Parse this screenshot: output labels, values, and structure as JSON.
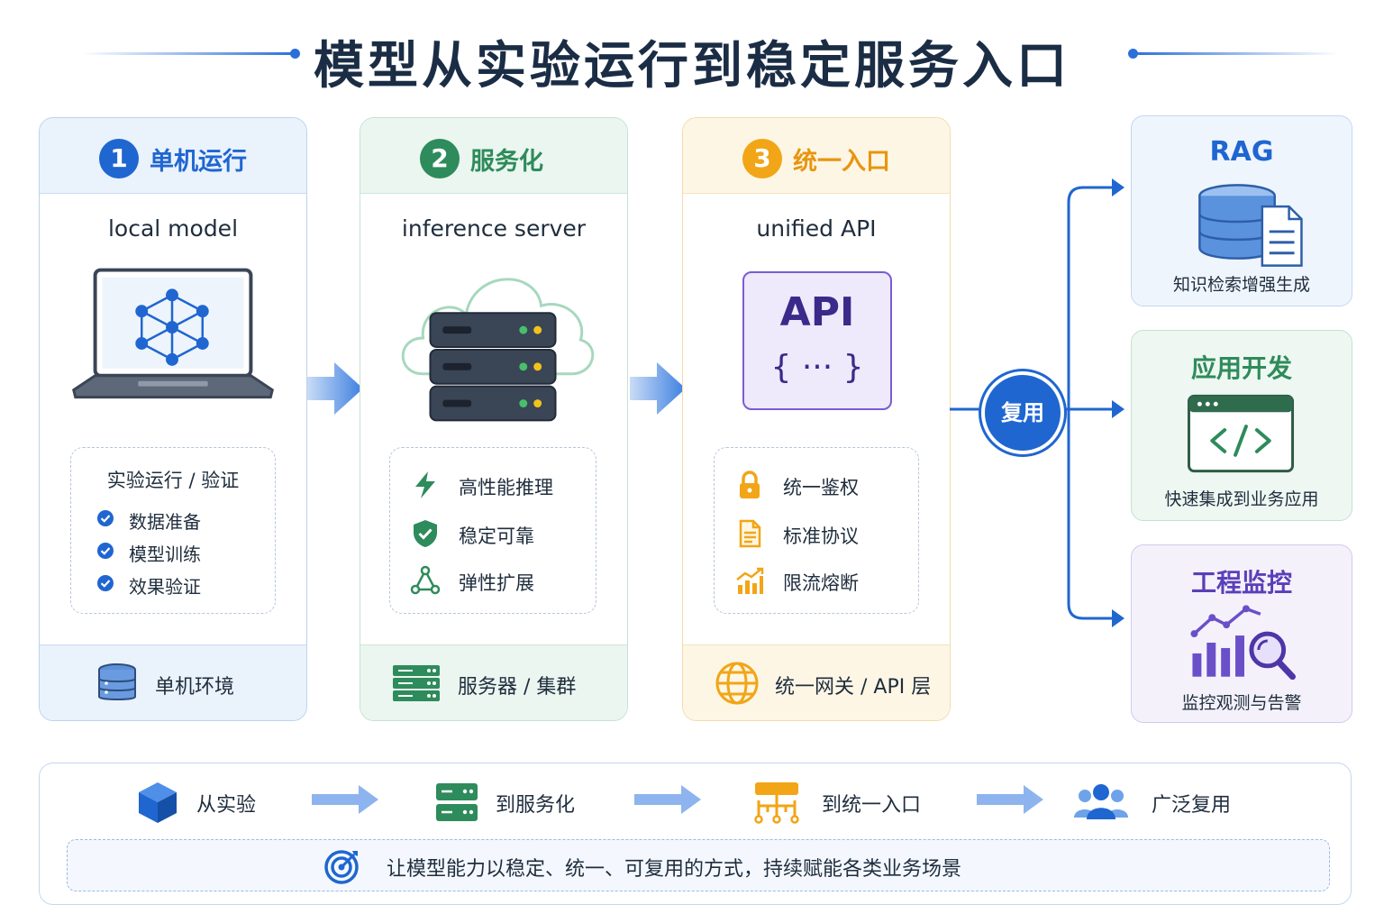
{
  "title": "模型从实验运行到稳定服务入口",
  "stages": [
    {
      "num": "1",
      "title": "单机运行",
      "subtitle": "local model",
      "box_title": "实验运行 / 验证",
      "items": [
        "数据准备",
        "模型训练",
        "效果验证"
      ],
      "footer": "单机环境"
    },
    {
      "num": "2",
      "title": "服务化",
      "subtitle": "inference server",
      "items": [
        "高性能推理",
        "稳定可靠",
        "弹性扩展"
      ],
      "footer": "服务器 / 集群"
    },
    {
      "num": "3",
      "title": "统一入口",
      "subtitle": "unified API",
      "api_label": "API",
      "api_braces": "{ ··· }",
      "items": [
        "统一鉴权",
        "标准协议",
        "限流熔断"
      ],
      "footer": "统一网关 / API 层"
    }
  ],
  "reuse_label": "复用",
  "outputs": [
    {
      "title": "RAG",
      "desc": "知识检索增强生成"
    },
    {
      "title": "应用开发",
      "desc": "快速集成到业务应用"
    },
    {
      "title": "工程监控",
      "desc": "监控观测与告警"
    }
  ],
  "flow": [
    "从实验",
    "到服务化",
    "到统一入口",
    "广泛复用"
  ],
  "mission": "让模型能力以稳定、统一、可复用的方式，持续赋能各类业务场景",
  "colors": {
    "blue": "#1f66d1",
    "green": "#2e8b5b",
    "orange": "#f2a516",
    "purple": "#5b3fb8"
  }
}
